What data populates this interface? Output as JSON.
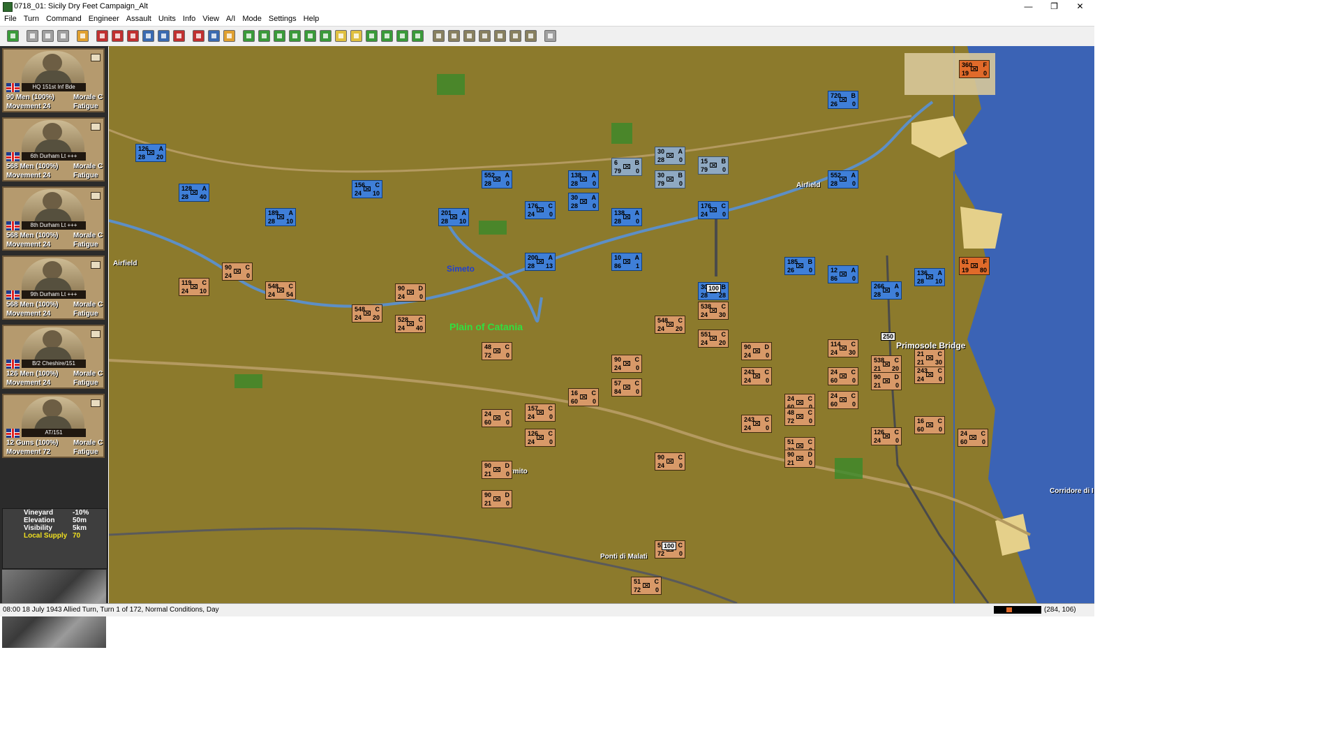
{
  "window": {
    "title": "0718_01: Sicily Dry Feet Campaign_Alt"
  },
  "menu": [
    "File",
    "Turn",
    "Command",
    "Engineer",
    "Assault",
    "Units",
    "Info",
    "View",
    "A/I",
    "Mode",
    "Settings",
    "Help"
  ],
  "toolbar": [
    {
      "icon": "target-icon",
      "color": "#3a9a3a"
    },
    {
      "icon": "page-icon",
      "color": "#a0a0a0"
    },
    {
      "icon": "folder-icon",
      "color": "#a0a0a0"
    },
    {
      "icon": "print-icon",
      "color": "#a0a0a0"
    },
    {
      "icon": "scroll-icon",
      "color": "#e0a030"
    },
    {
      "icon": "shield-icon",
      "color": "#c03030"
    },
    {
      "icon": "shield-s-icon",
      "color": "#c03030"
    },
    {
      "icon": "brush-icon",
      "color": "#c03030"
    },
    {
      "icon": "airplane-icon",
      "color": "#3a6ab0"
    },
    {
      "icon": "airplane-cross-icon",
      "color": "#3a6ab0"
    },
    {
      "icon": "list-icon",
      "color": "#c03030"
    },
    {
      "icon": "pencil-icon",
      "color": "#c03030"
    },
    {
      "icon": "globe-icon",
      "color": "#3a6ab0"
    },
    {
      "icon": "person-icon",
      "color": "#e0a030"
    },
    {
      "icon": "plus-icon",
      "color": "#3a9a3a"
    },
    {
      "icon": "minus-icon",
      "color": "#3a9a3a"
    },
    {
      "icon": "grid-icon",
      "color": "#3a9a3a"
    },
    {
      "icon": "frame-icon",
      "color": "#3a9a3a"
    },
    {
      "icon": "diamond-icon",
      "color": "#3a9a3a"
    },
    {
      "icon": "flag-icon",
      "color": "#3a9a3a"
    },
    {
      "icon": "bird-icon",
      "color": "#e0c040"
    },
    {
      "icon": "sun-icon",
      "color": "#e0c040"
    },
    {
      "icon": "terrain-icon",
      "color": "#3a9a3a"
    },
    {
      "icon": "monitor-icon",
      "color": "#3a9a3a"
    },
    {
      "icon": "map-icon",
      "color": "#3a9a3a"
    },
    {
      "icon": "swap-icon",
      "color": "#3a9a3a"
    },
    {
      "icon": "lock-icon",
      "color": "#888060"
    },
    {
      "icon": "binoculars-icon",
      "color": "#888060"
    },
    {
      "icon": "cup-icon",
      "color": "#888060"
    },
    {
      "icon": "clock-icon",
      "color": "#888060"
    },
    {
      "icon": "bars-icon",
      "color": "#888060"
    },
    {
      "icon": "tree-icon",
      "color": "#888060"
    },
    {
      "icon": "info-icon",
      "color": "#888060"
    },
    {
      "icon": "help-icon",
      "color": "#a0a0a0"
    }
  ],
  "cards": [
    {
      "name": "HQ 151st Inf Bde",
      "men": "90 Men (100%)",
      "morale": "Morale C",
      "movement": "Movement 24",
      "fatigue": "Fatigue 0"
    },
    {
      "name": "6th Durham Lt +++",
      "men": "568 Men (100%)",
      "morale": "Morale C",
      "movement": "Movement 24",
      "fatigue": "Fatigue 0"
    },
    {
      "name": "8th Durham Lt +++",
      "men": "568 Men (100%)",
      "morale": "Morale C",
      "movement": "Movement 24",
      "fatigue": "Fatigue 0"
    },
    {
      "name": "9th Durham Lt +++",
      "men": "568 Men (100%)",
      "morale": "Morale C",
      "movement": "Movement 24",
      "fatigue": "Fatigue 0"
    },
    {
      "name": "B/2 Cheshire/151",
      "men": "126 Men (100%)",
      "morale": "Morale C",
      "movement": "Movement 24",
      "fatigue": "Fatigue 0"
    },
    {
      "name": "AT/151",
      "men": "12 Guns (100%)",
      "morale": "Morale C",
      "movement": "Movement 72",
      "fatigue": "Fatigue 0"
    }
  ],
  "terrain": [
    {
      "label": "Vineyard",
      "value": "-10%"
    },
    {
      "label": "Elevation",
      "value": "50m"
    },
    {
      "label": "Visibility",
      "value": "5km"
    },
    {
      "label": "Local Supply",
      "value": "70"
    }
  ],
  "places": [
    {
      "name": "Airfield",
      "color": "#ffffff"
    },
    {
      "name": "Simeto",
      "color": "#2040d0"
    },
    {
      "name": "Plain of Catania",
      "color": "#30e040"
    },
    {
      "name": "Airfield",
      "color": "#ffffff"
    },
    {
      "name": "Primosole Bridge",
      "color": "#ffffff"
    },
    {
      "name": "Carmito",
      "color": "#ffffff"
    },
    {
      "name": "Ponti di Malati",
      "color": "#ffffff"
    },
    {
      "name": "Corridore di I",
      "color": "#ffffff"
    }
  ],
  "units": [
    {
      "s": "126",
      "q": "A",
      "a": "28",
      "m": "20",
      "side": "de"
    },
    {
      "s": "128",
      "q": "A",
      "a": "28",
      "m": "40",
      "side": "de"
    },
    {
      "s": "189",
      "q": "A",
      "a": "28",
      "m": "10",
      "side": "de"
    },
    {
      "s": "156",
      "q": "C",
      "a": "24",
      "m": "10",
      "side": "de"
    },
    {
      "s": "201",
      "q": "A",
      "a": "28",
      "m": "10",
      "side": "de"
    },
    {
      "s": "552",
      "q": "A",
      "a": "28",
      "m": "0",
      "side": "de"
    },
    {
      "s": "176",
      "q": "C",
      "a": "24",
      "m": "0",
      "side": "de"
    },
    {
      "s": "138",
      "q": "A",
      "a": "28",
      "m": "0",
      "side": "de"
    },
    {
      "s": "30",
      "q": "A",
      "a": "28",
      "m": "0",
      "side": "de"
    },
    {
      "s": "6",
      "q": "B",
      "a": "79",
      "m": "0",
      "side": "it"
    },
    {
      "s": "30",
      "q": "A",
      "a": "28",
      "m": "0",
      "side": "it"
    },
    {
      "s": "30",
      "q": "B",
      "a": "79",
      "m": "0",
      "side": "it"
    },
    {
      "s": "15",
      "q": "B",
      "a": "79",
      "m": "0",
      "side": "it"
    },
    {
      "s": "138",
      "q": "A",
      "a": "28",
      "m": "0",
      "side": "de"
    },
    {
      "s": "176",
      "q": "C",
      "a": "24",
      "m": "0",
      "side": "de"
    },
    {
      "s": "200",
      "q": "A",
      "a": "28",
      "m": "13",
      "side": "de"
    },
    {
      "s": "10",
      "q": "A",
      "a": "86",
      "m": "1",
      "side": "de"
    },
    {
      "s": "720",
      "q": "B",
      "a": "26",
      "m": "0",
      "side": "de"
    },
    {
      "s": "552",
      "q": "A",
      "a": "28",
      "m": "0",
      "side": "de"
    },
    {
      "s": "176",
      "q": "C",
      "a": "24",
      "m": "0",
      "side": "de"
    },
    {
      "s": "185",
      "q": "B",
      "a": "26",
      "m": "0",
      "side": "de"
    },
    {
      "s": "12",
      "q": "A",
      "a": "86",
      "m": "0",
      "side": "de"
    },
    {
      "s": "266",
      "q": "A",
      "a": "28",
      "m": "9",
      "side": "de"
    },
    {
      "s": "136",
      "q": "A",
      "a": "28",
      "m": "10",
      "side": "de"
    },
    {
      "s": "30",
      "q": "B",
      "a": "28",
      "m": "28",
      "side": "de"
    },
    {
      "s": "360",
      "q": "F",
      "a": "19",
      "m": "0",
      "side": "red"
    },
    {
      "s": "61",
      "q": "F",
      "a": "19",
      "m": "80",
      "side": "red"
    },
    {
      "s": "90",
      "q": "C",
      "a": "24",
      "m": "0",
      "side": "br"
    },
    {
      "s": "119",
      "q": "C",
      "a": "24",
      "m": "10",
      "side": "br"
    },
    {
      "s": "548",
      "q": "C",
      "a": "24",
      "m": "54",
      "side": "br"
    },
    {
      "s": "90",
      "q": "D",
      "a": "24",
      "m": "0",
      "side": "br"
    },
    {
      "s": "548",
      "q": "C",
      "a": "24",
      "m": "20",
      "side": "br"
    },
    {
      "s": "528",
      "q": "C",
      "a": "24",
      "m": "40",
      "side": "br"
    },
    {
      "s": "48",
      "q": "C",
      "a": "72",
      "m": "0",
      "side": "br"
    },
    {
      "s": "538",
      "q": "C",
      "a": "24",
      "m": "30",
      "side": "br"
    },
    {
      "s": "548",
      "q": "C",
      "a": "24",
      "m": "20",
      "side": "br"
    },
    {
      "s": "551",
      "q": "C",
      "a": "24",
      "m": "20",
      "side": "br"
    },
    {
      "s": "90",
      "q": "C",
      "a": "24",
      "m": "0",
      "side": "br"
    },
    {
      "s": "57",
      "q": "C",
      "a": "84",
      "m": "0",
      "side": "br"
    },
    {
      "s": "16",
      "q": "C",
      "a": "60",
      "m": "0",
      "side": "br"
    },
    {
      "s": "157",
      "q": "C",
      "a": "24",
      "m": "0",
      "side": "br"
    },
    {
      "s": "126",
      "q": "C",
      "a": "24",
      "m": "0",
      "side": "br"
    },
    {
      "s": "24",
      "q": "C",
      "a": "60",
      "m": "0",
      "side": "br"
    },
    {
      "s": "90",
      "q": "D",
      "a": "21",
      "m": "0",
      "side": "br"
    },
    {
      "s": "90",
      "q": "D",
      "a": "21",
      "m": "0",
      "side": "br"
    },
    {
      "s": "90",
      "q": "C",
      "a": "24",
      "m": "0",
      "side": "br"
    },
    {
      "s": "51",
      "q": "C",
      "a": "72",
      "m": "0",
      "side": "br"
    },
    {
      "s": "90",
      "q": "D",
      "a": "24",
      "m": "0",
      "side": "br"
    },
    {
      "s": "243",
      "q": "C",
      "a": "24",
      "m": "0",
      "side": "br"
    },
    {
      "s": "24",
      "q": "C",
      "a": "60",
      "m": "0",
      "side": "br"
    },
    {
      "s": "48",
      "q": "C",
      "a": "72",
      "m": "0",
      "side": "br"
    },
    {
      "s": "51",
      "q": "C",
      "a": "72",
      "m": "0",
      "side": "br"
    },
    {
      "s": "90",
      "q": "D",
      "a": "21",
      "m": "0",
      "side": "br"
    },
    {
      "s": "243",
      "q": "C",
      "a": "24",
      "m": "0",
      "side": "br"
    },
    {
      "s": "114",
      "q": "C",
      "a": "24",
      "m": "30",
      "side": "br"
    },
    {
      "s": "24",
      "q": "C",
      "a": "60",
      "m": "0",
      "side": "br"
    },
    {
      "s": "24",
      "q": "C",
      "a": "60",
      "m": "0",
      "side": "br"
    },
    {
      "s": "538",
      "q": "C",
      "a": "21",
      "m": "20",
      "side": "br"
    },
    {
      "s": "90",
      "q": "D",
      "a": "21",
      "m": "0",
      "side": "br"
    },
    {
      "s": "243",
      "q": "C",
      "a": "24",
      "m": "0",
      "side": "br"
    },
    {
      "s": "21",
      "q": "C",
      "a": "21",
      "m": "30",
      "side": "br"
    },
    {
      "s": "16",
      "q": "C",
      "a": "60",
      "m": "0",
      "side": "br"
    },
    {
      "s": "126",
      "q": "C",
      "a": "24",
      "m": "0",
      "side": "br"
    },
    {
      "s": "24",
      "q": "C",
      "a": "60",
      "m": "0",
      "side": "br"
    },
    {
      "s": "51",
      "q": "C",
      "a": "72",
      "m": "0",
      "side": "br"
    }
  ],
  "map_badges": [
    "100",
    "250",
    "100"
  ],
  "status": {
    "text": "08:00 18 July 1943 Allied Turn, Turn 1 of 172, Normal Conditions, Day",
    "coords": "(284, 106)"
  }
}
